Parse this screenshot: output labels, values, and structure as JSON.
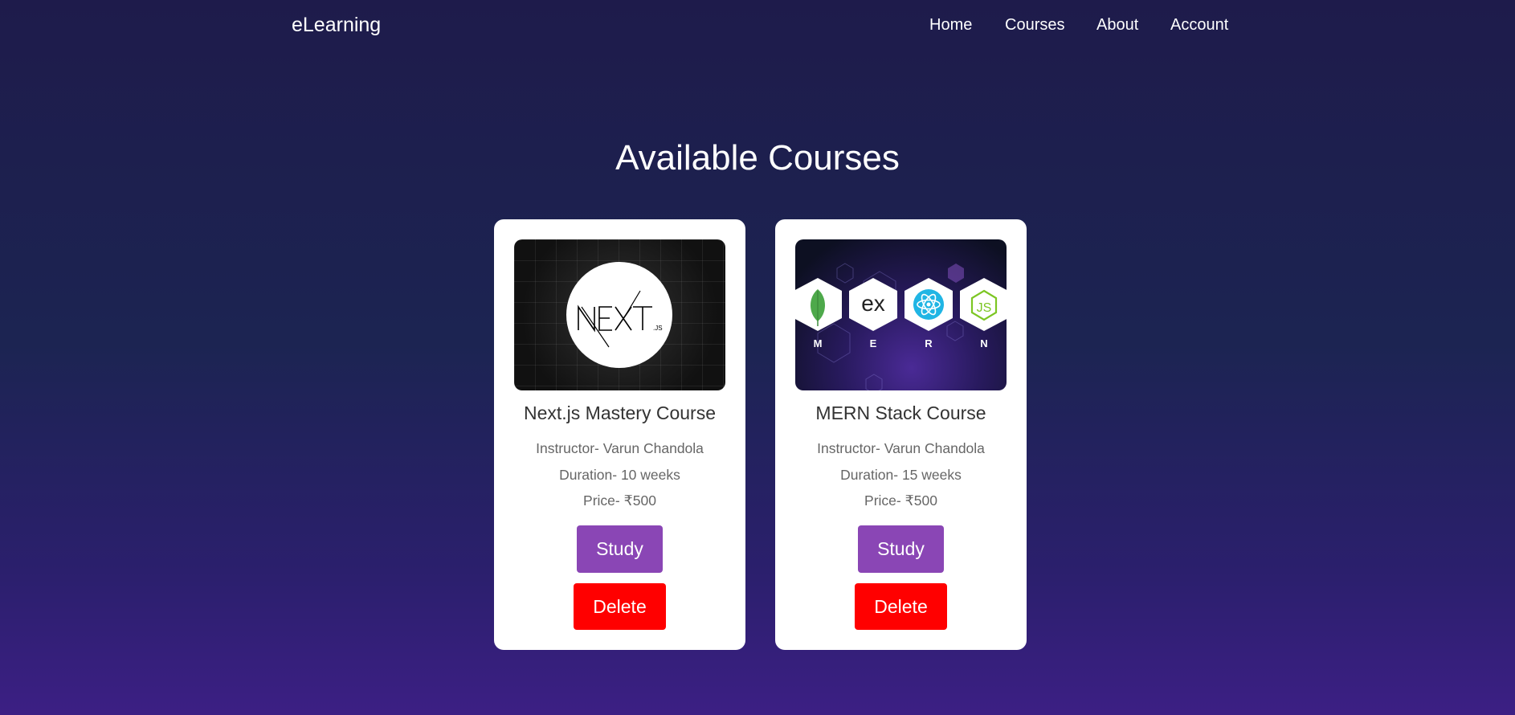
{
  "nav": {
    "brand": "eLearning",
    "links": [
      "Home",
      "Courses",
      "About",
      "Account"
    ]
  },
  "page": {
    "title": "Available Courses"
  },
  "courses": [
    {
      "name": "Next.js Mastery Course",
      "instructor": "Instructor- Varun Chandola",
      "duration": "Duration- 10 weeks",
      "price": "Price- ₹500",
      "study_label": "Study",
      "delete_label": "Delete",
      "thumb_text": "NEXT.js"
    },
    {
      "name": "MERN Stack Course",
      "instructor": "Instructor- Varun Chandola",
      "duration": "Duration- 15 weeks",
      "price": "Price- ₹500",
      "study_label": "Study",
      "delete_label": "Delete",
      "thumb_letters": [
        "M",
        "E",
        "R",
        "N"
      ]
    }
  ],
  "colors": {
    "study": "#8a46b5",
    "delete": "#ff0000",
    "card": "#ffffff"
  }
}
